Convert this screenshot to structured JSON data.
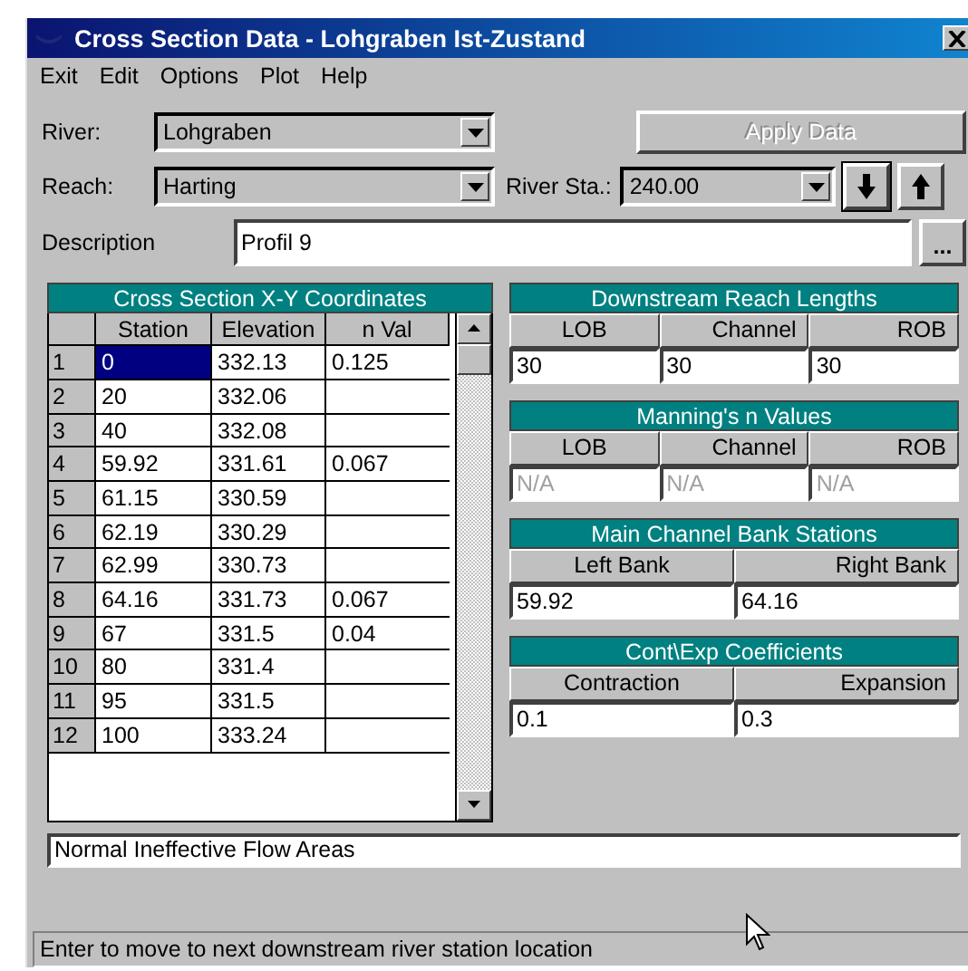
{
  "window": {
    "title": "Cross Section Data - Lohgraben Ist-Zustand"
  },
  "menu": [
    "Exit",
    "Edit",
    "Options",
    "Plot",
    "Help"
  ],
  "river": {
    "label": "River:",
    "value": "Lohgraben"
  },
  "apply_button": {
    "label": "Apply Data",
    "disabled": true
  },
  "reach": {
    "label": "Reach:",
    "value": "Harting"
  },
  "river_station": {
    "label": "River Sta.:",
    "value": "240.00"
  },
  "description": {
    "label": "Description",
    "value": "Profil 9",
    "browse": "..."
  },
  "coordinates": {
    "title": "Cross Section X-Y Coordinates",
    "columns": [
      "Station",
      "Elevation",
      "n Val"
    ],
    "rows": [
      {
        "index": "1",
        "cells": [
          "0",
          "332.13",
          "0.125"
        ],
        "selected": true
      },
      {
        "index": "2",
        "cells": [
          "20",
          "332.06",
          ""
        ],
        "selected": false
      },
      {
        "index": "3",
        "cells": [
          "40",
          "332.08",
          ""
        ],
        "selected": false
      },
      {
        "index": "4",
        "cells": [
          "59.92",
          "331.61",
          "0.067"
        ],
        "selected": false
      },
      {
        "index": "5",
        "cells": [
          "61.15",
          "330.59",
          ""
        ],
        "selected": false
      },
      {
        "index": "6",
        "cells": [
          "62.19",
          "330.29",
          ""
        ],
        "selected": false
      },
      {
        "index": "7",
        "cells": [
          "62.99",
          "330.73",
          ""
        ],
        "selected": false
      },
      {
        "index": "8",
        "cells": [
          "64.16",
          "331.73",
          "0.067"
        ],
        "selected": false
      },
      {
        "index": "9",
        "cells": [
          "67",
          "331.5",
          "0.04"
        ],
        "selected": false
      },
      {
        "index": "10",
        "cells": [
          "80",
          "331.4",
          ""
        ],
        "selected": false
      },
      {
        "index": "11",
        "cells": [
          "95",
          "331.5",
          ""
        ],
        "selected": false
      },
      {
        "index": "12",
        "cells": [
          "100",
          "333.24",
          ""
        ],
        "selected": false
      }
    ]
  },
  "panels": [
    {
      "title": "Downstream Reach Lengths",
      "fields": [
        {
          "label": "LOB",
          "value": "30",
          "disabled": false
        },
        {
          "label": "Channel",
          "value": "30",
          "disabled": false
        },
        {
          "label": "ROB",
          "value": "30",
          "disabled": false
        }
      ]
    },
    {
      "title": "Manning's n Values",
      "fields": [
        {
          "label": "LOB",
          "value": "N/A",
          "disabled": true
        },
        {
          "label": "Channel",
          "value": "N/A",
          "disabled": true
        },
        {
          "label": "ROB",
          "value": "N/A",
          "disabled": true
        }
      ]
    },
    {
      "title": "Main Channel Bank Stations",
      "fields": [
        {
          "label": "Left Bank",
          "value": "59.92",
          "disabled": false
        },
        {
          "label": "Right Bank",
          "value": "64.16",
          "disabled": false
        }
      ]
    },
    {
      "title": "Cont\\Exp  Coefficients",
      "fields": [
        {
          "label": "Contraction",
          "value": "0.1",
          "disabled": false
        },
        {
          "label": "Expansion",
          "value": "0.3",
          "disabled": false
        }
      ]
    }
  ],
  "ineffective": "Normal Ineffective Flow Areas",
  "status_bar": "Enter to move to next downstream river station location"
}
